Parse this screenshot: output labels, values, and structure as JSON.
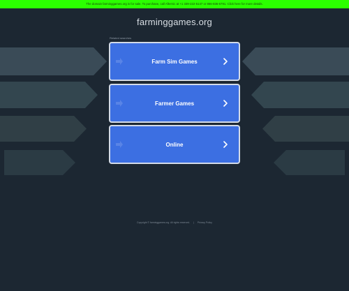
{
  "banner": {
    "text": "The domain farminggames.org is for sale. To purchase, call Afternic at +1 339-222-5147 or 866-836-6791. Click here for more details."
  },
  "header": {
    "domain": "farminggames.org"
  },
  "related": {
    "label": "Related searches",
    "items": [
      {
        "label": "Farm Sim Games"
      },
      {
        "label": "Farmer Games"
      },
      {
        "label": "Online"
      }
    ]
  },
  "footer": {
    "copyright": "Copyright © farminggames.org. All rights reserved.",
    "separator": "|",
    "privacy": "Privacy Policy"
  },
  "colors": {
    "background": "#1c2732",
    "banner": "#2bff00",
    "card": "#3c6fe2",
    "card_border": "#d3dbe8"
  },
  "icons": {
    "card_arrow": "chevron-right-icon"
  }
}
